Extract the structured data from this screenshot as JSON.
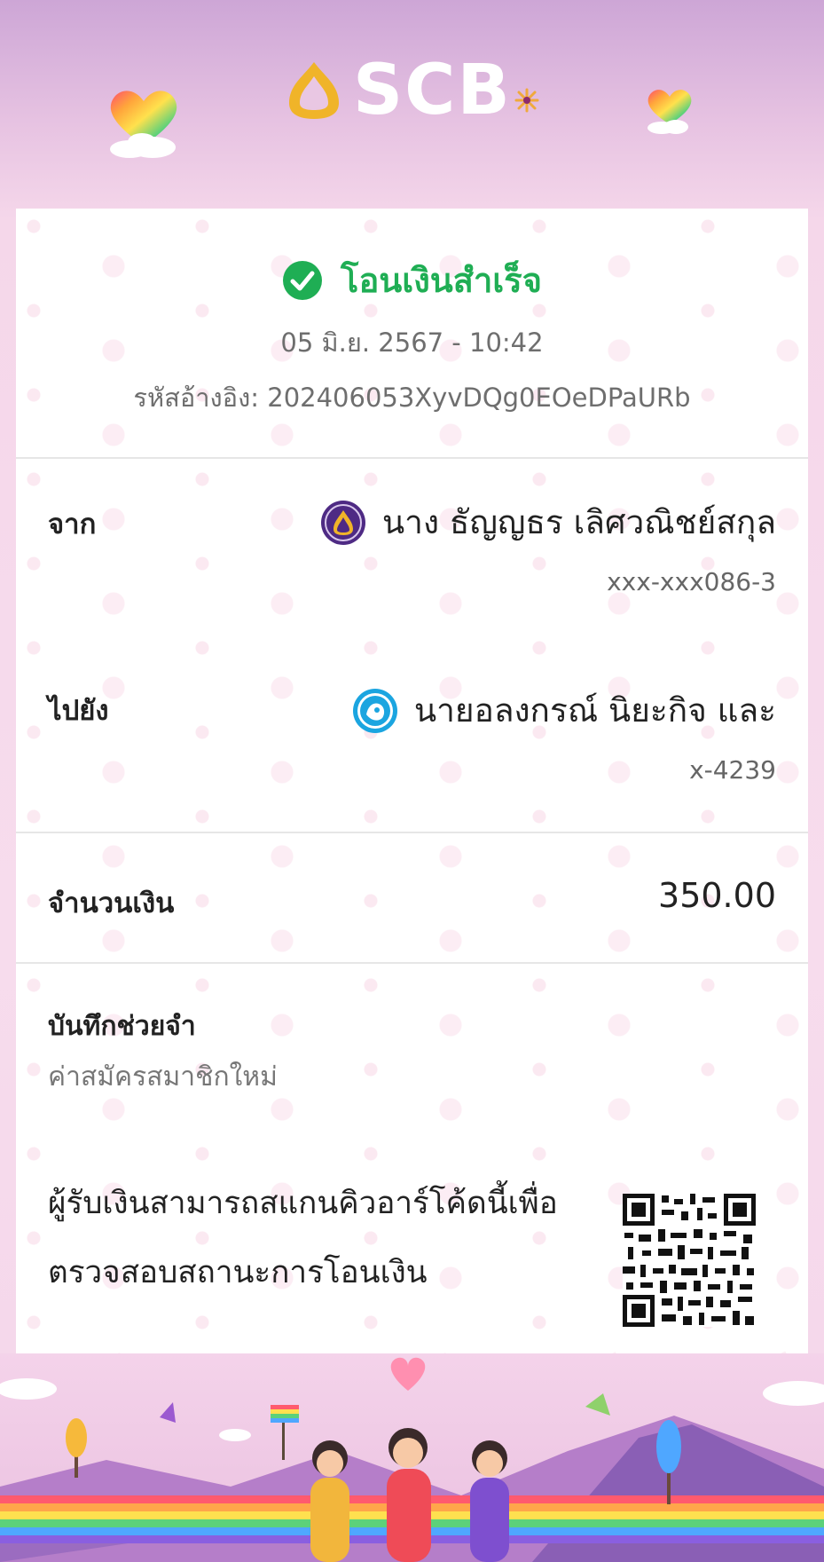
{
  "brand": {
    "name": "SCB"
  },
  "receipt": {
    "status": "โอนเงินสำเร็จ",
    "datetime": "05 มิ.ย. 2567 - 10:42",
    "reference": "รหัสอ้างอิง: 202406053XyvDQg0EOeDPaURb",
    "from": {
      "label": "จาก",
      "name": "นาง ธัญญธร เลิศวณิชย์สกุล",
      "account": "xxx-xxx086-3"
    },
    "to": {
      "label": "ไปยัง",
      "name": "นายอลงกรณ์ นิยะกิจ และ",
      "account": "x-4239"
    },
    "amount": {
      "label": "จำนวนเงิน",
      "value": "350.00"
    },
    "memo": {
      "label": "บันทึกช่วยจำ",
      "value": "ค่าสมัครสมาชิกใหม่"
    },
    "qr": {
      "line1": "ผู้รับเงินสามารถสแกนคิวอาร์โค้ดนี้เพื่อ",
      "line2": "ตรวจสอบสถานะการโอนเงิน"
    }
  },
  "colors": {
    "success": "#1fae54",
    "scb_purple": "#4e2a84",
    "scb_gold": "#f0b429",
    "ktb_blue": "#1ba5e0"
  },
  "icons": [
    "scb-logo-icon",
    "rainbow-heart-icon",
    "check-circle-icon",
    "scb-bank-icon",
    "ktb-bank-icon",
    "qr-code-icon"
  ]
}
